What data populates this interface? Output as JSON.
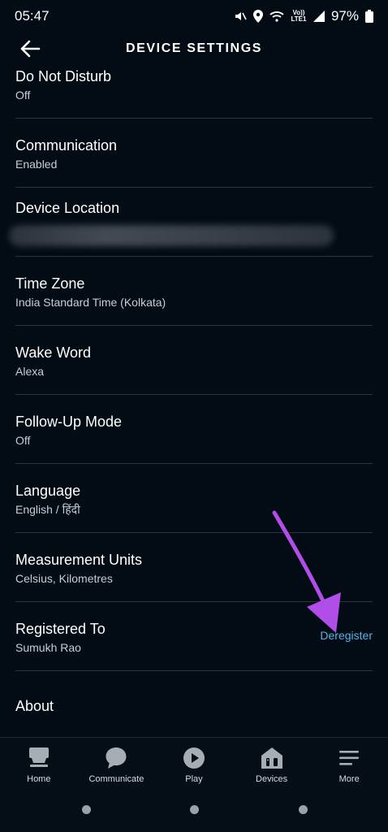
{
  "status": {
    "time": "05:47",
    "battery": "97%",
    "network": "Vo)) LTE1"
  },
  "header": {
    "title": "DEVICE SETTINGS"
  },
  "settings": [
    {
      "title": "Do Not Disturb",
      "subtitle": "Off"
    },
    {
      "title": "Communication",
      "subtitle": "Enabled"
    },
    {
      "title": "Device Location",
      "subtitle": ""
    },
    {
      "title": "Time Zone",
      "subtitle": "India Standard Time (Kolkata)"
    },
    {
      "title": "Wake Word",
      "subtitle": "Alexa"
    },
    {
      "title": "Follow-Up Mode",
      "subtitle": "Off"
    },
    {
      "title": "Language",
      "subtitle": "English / हिंदी"
    },
    {
      "title": "Measurement Units",
      "subtitle": "Celsius, Kilometres"
    },
    {
      "title": "Registered To",
      "subtitle": "Sumukh Rao",
      "action": "Deregister"
    },
    {
      "title": "About",
      "subtitle": ""
    }
  ],
  "nav": [
    {
      "label": "Home",
      "icon": "home-icon"
    },
    {
      "label": "Communicate",
      "icon": "chat-icon"
    },
    {
      "label": "Play",
      "icon": "play-icon"
    },
    {
      "label": "Devices",
      "icon": "devices-icon"
    },
    {
      "label": "More",
      "icon": "menu-icon"
    }
  ],
  "colors": {
    "background": "#030b14",
    "accent": "#56b5ea",
    "annotation_arrow": "#b14ee8"
  }
}
